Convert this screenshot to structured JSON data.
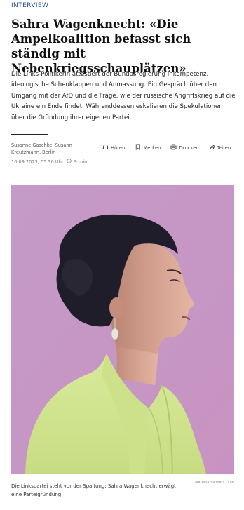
{
  "article": {
    "kicker": "INTERVIEW",
    "headline": "Sahra Wagenknecht: «Die Ampelkoalition befasst sich ständig mit Nebenkriegsschauplätzen»",
    "lead": "Die Links-Politikerin attestiert der Bundesregierung Inkompetenz, ideologische Scheuklappen und Anmassung. Ein Gespräch über den Umgang mit der AfD und die Frage, wie der russische Angriffskrieg auf die Ukraine ein Ende findet. Währenddessen eskalieren die Spekulationen über die Gründung ihrer eigenen Partei.",
    "authors": "Susanne Gaschke, Susann Kreutzmann, Berlin",
    "date": "10.09.2023, 05.30 Uhr",
    "reading_time": "9 min"
  },
  "actions": {
    "listen_label": "Hören",
    "bookmark_label": "Merken",
    "print_label": "Drucken",
    "share_label": "Teilen"
  },
  "image": {
    "caption": "Die Linkspartei steht vor der Spaltung: Sahra Wagenknecht erwägt eine Parteigründung.",
    "credit": "Mariana Saubatz / Laif",
    "background_color": "#c698c4"
  }
}
